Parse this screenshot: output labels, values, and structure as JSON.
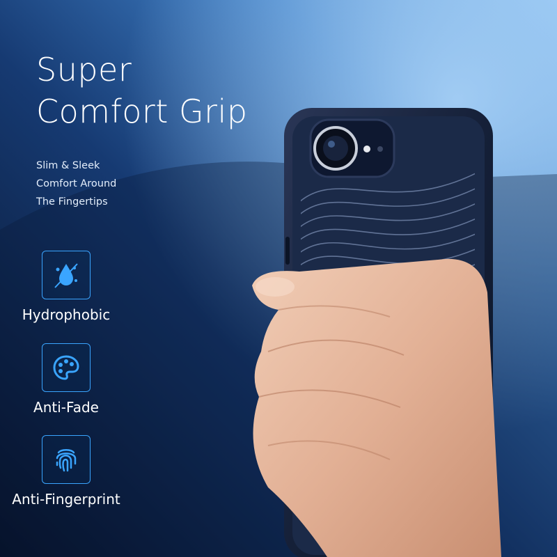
{
  "headline": {
    "line1": "Super",
    "line2": "Comfort Grip"
  },
  "subtitle": {
    "line1": "Slim & Sleek",
    "line2": "Comfort Around",
    "line3": "The Fingertips"
  },
  "features": [
    {
      "label": "Hydrophobic",
      "icon": "water-drop-icon"
    },
    {
      "label": "Anti-Fade",
      "icon": "palette-icon"
    },
    {
      "label": "Anti-Fingerprint",
      "icon": "fingerprint-icon"
    }
  ],
  "colors": {
    "accent": "#3aa5ff",
    "text": "#ffffff",
    "background_dark": "#08142c",
    "background_light": "#7fb6ec",
    "case": "#1a2540"
  }
}
